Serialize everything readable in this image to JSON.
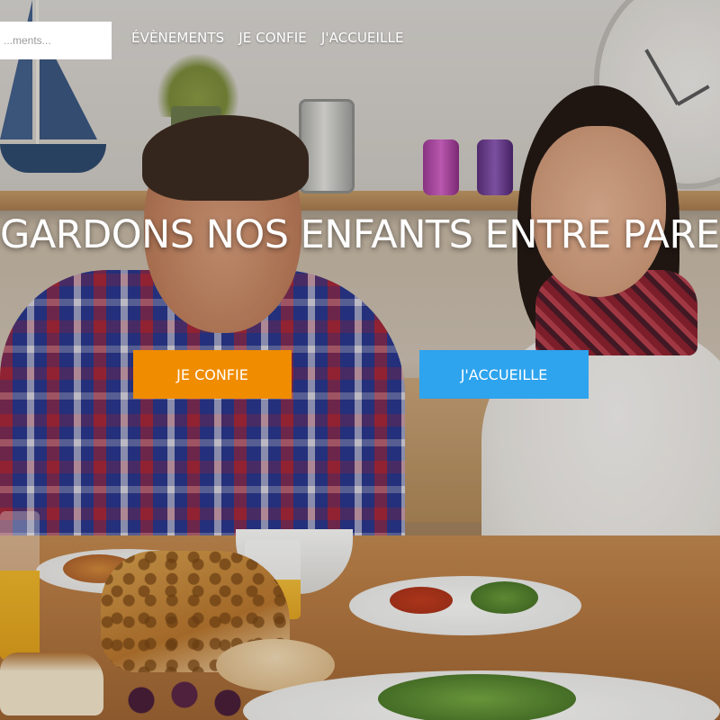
{
  "search": {
    "placeholder": "...ments..."
  },
  "nav": {
    "items": [
      {
        "label": "ÉVÈNEMENTS"
      },
      {
        "label": "JE CONFIE"
      },
      {
        "label": "J'ACCUEILLE"
      }
    ]
  },
  "hero": {
    "title": "GARDONS NOS ENFANTS ENTRE PARENTS",
    "buttons": {
      "confie": {
        "label": "JE CONFIE",
        "color": "#f08c00"
      },
      "accueille": {
        "label": "J'ACCUEILLE",
        "color": "#2ea3ee"
      }
    },
    "background_image": "family-dinner-photo"
  },
  "theme": {
    "text_color": "#ffffff",
    "search_bg": "#ffffff"
  }
}
